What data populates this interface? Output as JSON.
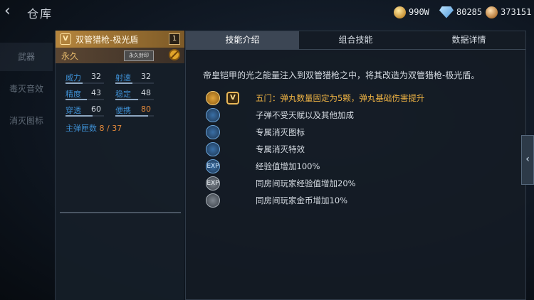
{
  "header": {
    "title": "仓库",
    "currencies": [
      {
        "name": "gold-coin-icon",
        "value": "990W"
      },
      {
        "name": "diamond-icon",
        "value": "80285"
      },
      {
        "name": "cash-coin-icon",
        "value": "373151"
      }
    ]
  },
  "sidebar": {
    "items": [
      {
        "label": "武器"
      },
      {
        "label": "毒灭音效"
      },
      {
        "label": "消灭图标"
      }
    ]
  },
  "weapon": {
    "badge": "V",
    "name": "双管猎枪-极光盾",
    "count": "1",
    "duration": "永久",
    "seal_label": "永久封印",
    "stats": [
      {
        "label": "威力",
        "value": "32",
        "fill": 0.45
      },
      {
        "label": "射速",
        "value": "32",
        "fill": 0.45
      },
      {
        "label": "精度",
        "value": "43",
        "fill": 0.55
      },
      {
        "label": "稳定",
        "value": "48",
        "fill": 0.6
      },
      {
        "label": "穿透",
        "value": "60",
        "fill": 0.7
      },
      {
        "label": "便携",
        "value": "80",
        "fill": 0.85
      }
    ],
    "ammo_label": "主弹匣数",
    "ammo_value": "8 / 37"
  },
  "tabs": [
    {
      "label": "技能介绍",
      "active": true
    },
    {
      "label": "组合技能",
      "active": false
    },
    {
      "label": "数据详情",
      "active": false
    }
  ],
  "skills_panel": {
    "description": "帝皇铠甲的光之能量注入到双管猎枪之中，将其改造为双管猎枪-极光盾。",
    "v_badge": "V",
    "skills": [
      {
        "icon": "shotgun-shell-icon",
        "style": "gold",
        "glyph": "",
        "text": "五门：弹丸数量固定为5颗，弹丸基础伤害提升",
        "highlight": true
      },
      {
        "icon": "bullet-icon",
        "style": "blue",
        "glyph": "",
        "text": "子弹不受天赋以及其他加成",
        "highlight": false
      },
      {
        "icon": "kill-icon",
        "style": "blue",
        "glyph": "",
        "text": "专属消灭图标",
        "highlight": false
      },
      {
        "icon": "kill-effect-icon",
        "style": "blue",
        "glyph": "",
        "text": "专属消灭特效",
        "highlight": false
      },
      {
        "icon": "exp-icon",
        "style": "blue",
        "glyph": "EXP",
        "text": "经验值增加100%",
        "highlight": false
      },
      {
        "icon": "room-exp-icon",
        "style": "gray",
        "glyph": "EXP",
        "text": "同房间玩家经验值增加20%",
        "highlight": false
      },
      {
        "icon": "room-gold-icon",
        "style": "gray",
        "glyph": "",
        "text": "同房间玩家金币增加10%",
        "highlight": false
      }
    ]
  }
}
